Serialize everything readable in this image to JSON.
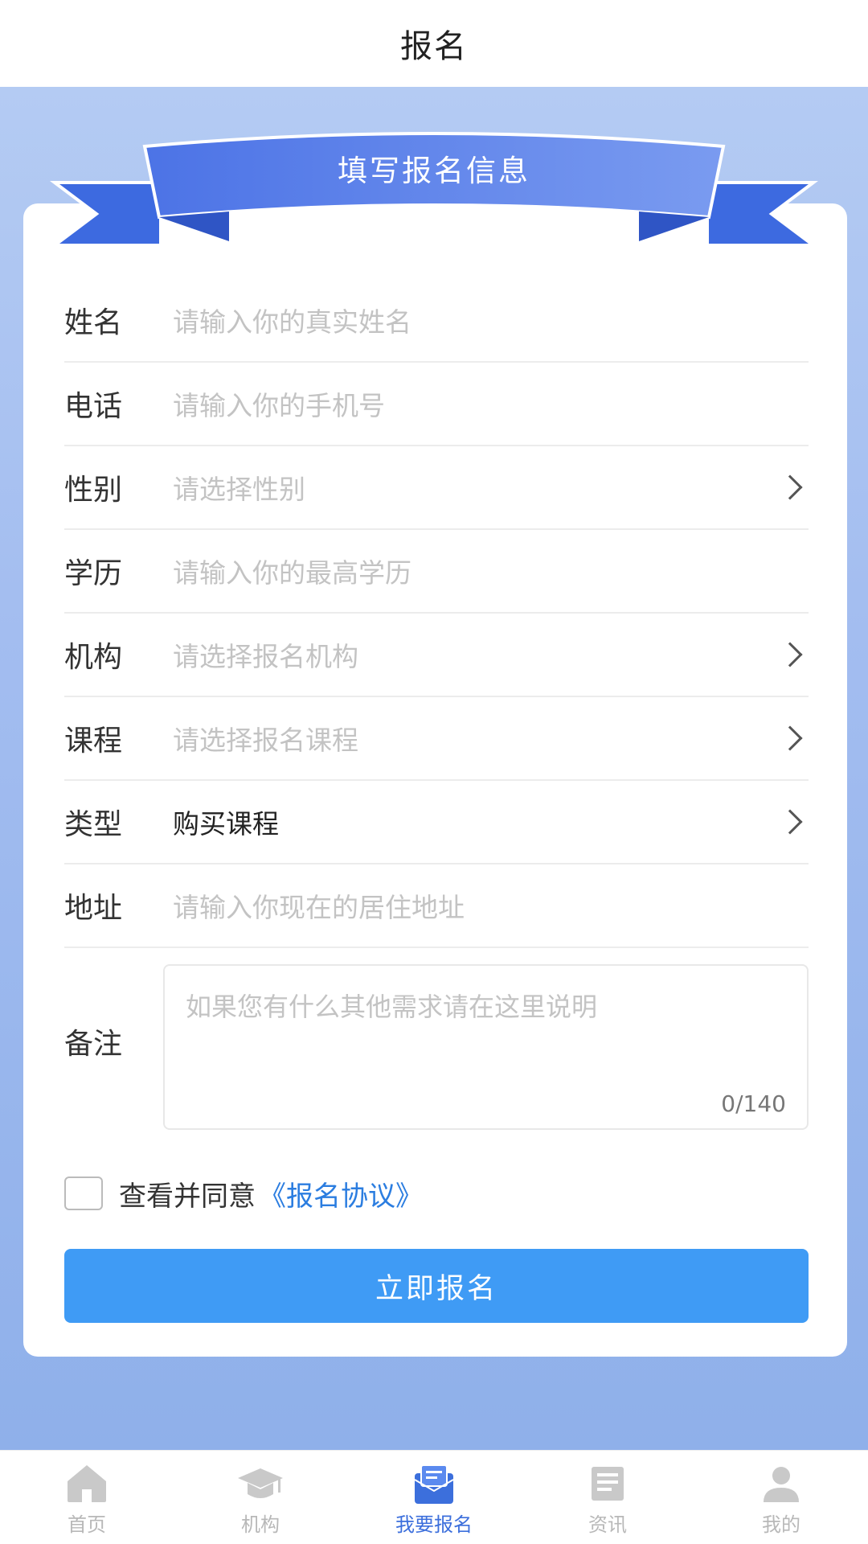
{
  "header": {
    "title": "报名"
  },
  "banner": {
    "title": "填写报名信息"
  },
  "form": {
    "fields": [
      {
        "label": "姓名",
        "placeholder": "请输入你的真实姓名"
      },
      {
        "label": "电话",
        "placeholder": "请输入你的手机号"
      },
      {
        "label": "性别",
        "placeholder": "请选择性别"
      },
      {
        "label": "学历",
        "placeholder": "请输入你的最高学历"
      },
      {
        "label": "机构",
        "placeholder": "请选择报名机构"
      },
      {
        "label": "课程",
        "placeholder": "请选择报名课程"
      },
      {
        "label": "类型",
        "value": "购买课程"
      },
      {
        "label": "地址",
        "placeholder": "请输入你现在的居住地址"
      }
    ],
    "note": {
      "label": "备注",
      "placeholder": "如果您有什么其他需求请在这里说明",
      "counter": "0/140"
    }
  },
  "agreement": {
    "text": "查看并同意",
    "link": "《报名协议》"
  },
  "submit_label": "立即报名",
  "tabbar": {
    "items": [
      {
        "label": "首页",
        "icon": "home-icon"
      },
      {
        "label": "机构",
        "icon": "graduation-cap-icon"
      },
      {
        "label": "我要报名",
        "icon": "signup-icon",
        "active": true
      },
      {
        "label": "资讯",
        "icon": "news-icon"
      },
      {
        "label": "我的",
        "icon": "user-icon"
      }
    ]
  },
  "colors": {
    "accent": "#3f9bf5",
    "tab_active": "#3c6fdc",
    "ribbon": "#5b84ea"
  }
}
